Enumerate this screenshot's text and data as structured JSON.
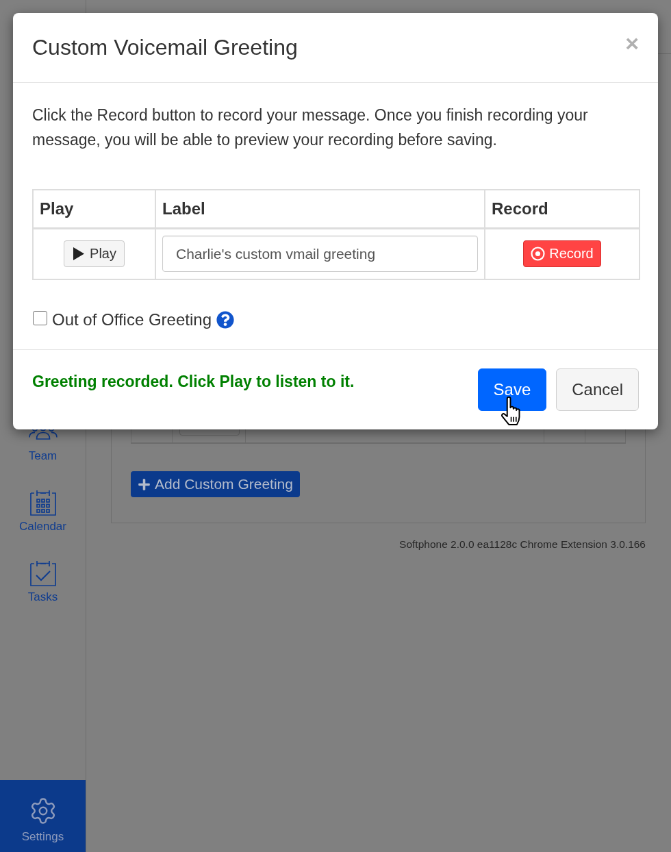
{
  "sidebar": {
    "items": [
      {
        "kind": "team",
        "label": "Team",
        "selected": false
      },
      {
        "kind": "calendar",
        "label": "Calendar",
        "selected": false
      },
      {
        "kind": "tasks",
        "label": "Tasks",
        "selected": false
      },
      {
        "kind": "settings",
        "label": "Settings",
        "selected": true
      }
    ]
  },
  "page": {
    "add_button": "Add Custom Greeting",
    "version": "Softphone 2.0.0 ea1128c Chrome Extension 3.0.166"
  },
  "dialog": {
    "title": "Custom Voicemail Greeting",
    "close": "×",
    "intro": "Click the Record button to record your message. Once you finish recording your message, you will be able to preview your recording before saving.",
    "table": {
      "columns": [
        "Play",
        "Label",
        "Record"
      ],
      "rows": [
        {
          "play": "Play",
          "label": "Charlie's custom vmail greeting",
          "record": "Record"
        }
      ]
    },
    "out_of_office": {
      "label": "Out of Office Greeting",
      "checked": false
    },
    "status": "Greeting recorded. Click Play to listen to it.",
    "buttons": [
      {
        "kind": "primary",
        "label": "Save"
      },
      {
        "kind": "secondary",
        "label": "Cancel"
      }
    ]
  }
}
